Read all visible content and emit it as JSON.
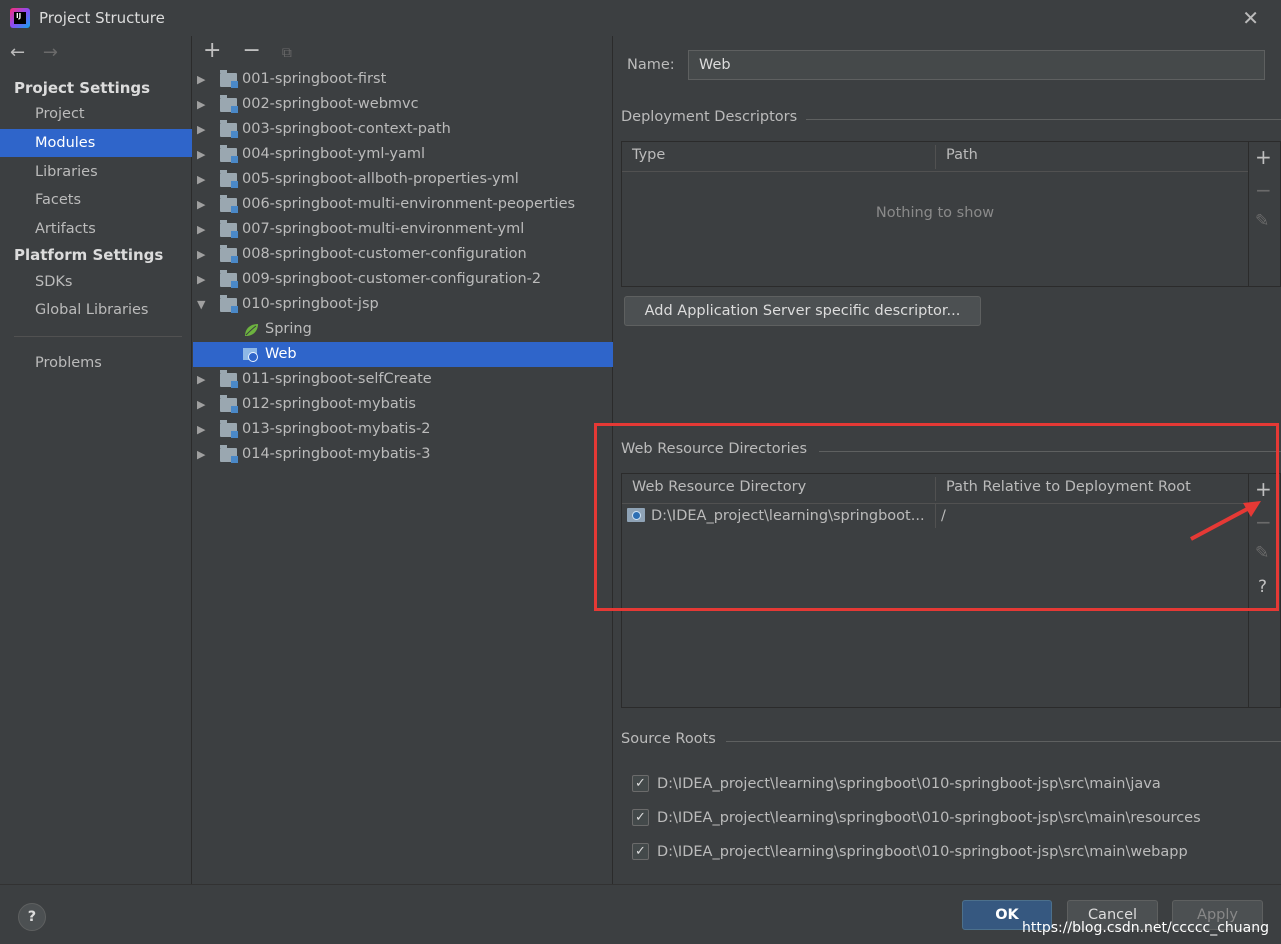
{
  "window": {
    "title": "Project Structure"
  },
  "nav": {
    "back": "←",
    "forward": "→",
    "project_settings_label": "Project Settings",
    "project_items": [
      "Project",
      "Modules",
      "Libraries",
      "Facets",
      "Artifacts"
    ],
    "selected": "Modules",
    "platform_settings_label": "Platform Settings",
    "platform_items": [
      "SDKs",
      "Global Libraries"
    ],
    "problems": "Problems"
  },
  "tree": {
    "tools": {
      "add": "+",
      "remove": "−",
      "copy": "⧉"
    },
    "modules": [
      "001-springboot-first",
      "002-springboot-webmvc",
      "003-springboot-context-path",
      "004-springboot-yml-yaml",
      "005-springboot-allboth-properties-yml",
      "006-springboot-multi-environment-peoperties",
      "007-springboot-multi-environment-yml",
      "008-springboot-customer-configuration",
      "009-springboot-customer-configuration-2",
      "010-springboot-jsp",
      "011-springboot-selfCreate",
      "012-springboot-mybatis",
      "013-springboot-mybatis-2",
      "014-springboot-mybatis-3"
    ],
    "expanded_children": [
      "Spring",
      "Web"
    ],
    "selected": "Web"
  },
  "details": {
    "name_label": "Name:",
    "name_value": "Web",
    "deployment_descriptors": {
      "title": "Deployment Descriptors",
      "columns": [
        "Type",
        "Path"
      ],
      "empty_text": "Nothing to show",
      "add_button": "Add Application Server specific descriptor..."
    },
    "web_resource_directories": {
      "title": "Web Resource Directories",
      "columns": [
        "Web Resource Directory",
        "Path Relative to Deployment Root"
      ],
      "rows": [
        {
          "directory": "D:\\IDEA_project\\learning\\springboot...",
          "relative_path": "/"
        }
      ]
    },
    "source_roots": {
      "title": "Source Roots",
      "items": [
        {
          "path": "D:\\IDEA_project\\learning\\springboot\\010-springboot-jsp\\src\\main\\java",
          "checked": true
        },
        {
          "path": "D:\\IDEA_project\\learning\\springboot\\010-springboot-jsp\\src\\main\\resources",
          "checked": true
        },
        {
          "path": "D:\\IDEA_project\\learning\\springboot\\010-springboot-jsp\\src\\main\\webapp",
          "checked": true
        }
      ]
    },
    "tools": {
      "add": "+",
      "remove": "−",
      "edit": "✎",
      "help": "?"
    }
  },
  "footer": {
    "help": "?",
    "ok": "OK",
    "cancel": "Cancel",
    "apply": "Apply",
    "watermark": "https://blog.csdn.net/ccccc_chuang"
  },
  "colors": {
    "background": "#3c3f41",
    "selection": "#2f65ca",
    "highlight_box": "#e53935",
    "primary_button": "#365880"
  }
}
